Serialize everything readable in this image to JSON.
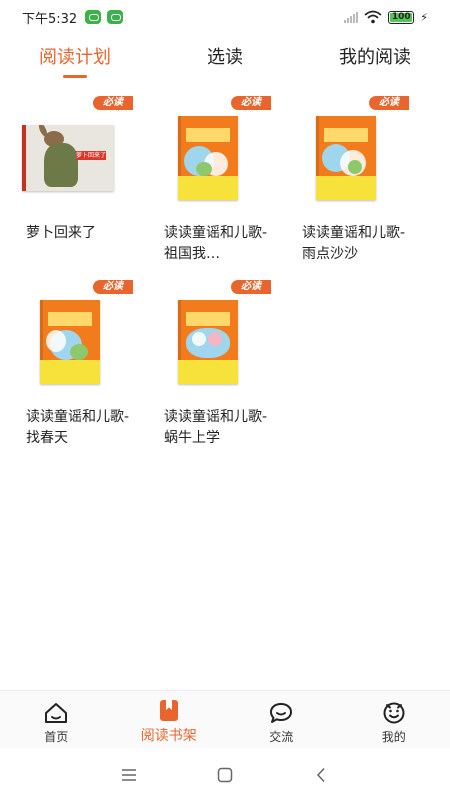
{
  "status_bar": {
    "time": "下午5:32",
    "battery": "100",
    "notification_icons": [
      "wechat-icon",
      "wechat-icon"
    ]
  },
  "tabs": [
    {
      "label": "阅读计划",
      "active": true
    },
    {
      "label": "选读",
      "active": false
    },
    {
      "label": "我的阅读",
      "active": false
    }
  ],
  "badge_label": "必读",
  "books": [
    {
      "title": "萝卜回来了",
      "cover": "rabbit",
      "cover_text": "萝卜回来了"
    },
    {
      "title": "读读童谣和儿歌-祖国我…",
      "cover": "orange"
    },
    {
      "title": "读读童谣和儿歌-雨点沙沙",
      "cover": "orange"
    },
    {
      "title": "读读童谣和儿歌-找春天",
      "cover": "orange"
    },
    {
      "title": "读读童谣和儿歌-蜗牛上学",
      "cover": "orange"
    }
  ],
  "bottom_nav": [
    {
      "label": "首页",
      "icon": "home-icon",
      "active": false
    },
    {
      "label": "阅读书架",
      "icon": "bookmark-icon",
      "active": true
    },
    {
      "label": "交流",
      "icon": "chat-icon",
      "active": false
    },
    {
      "label": "我的",
      "icon": "smiley-icon",
      "active": false
    }
  ],
  "colors": {
    "accent": "#e8662e",
    "book_orange": "#f27b1c",
    "book_yellow": "#f6e23a"
  }
}
